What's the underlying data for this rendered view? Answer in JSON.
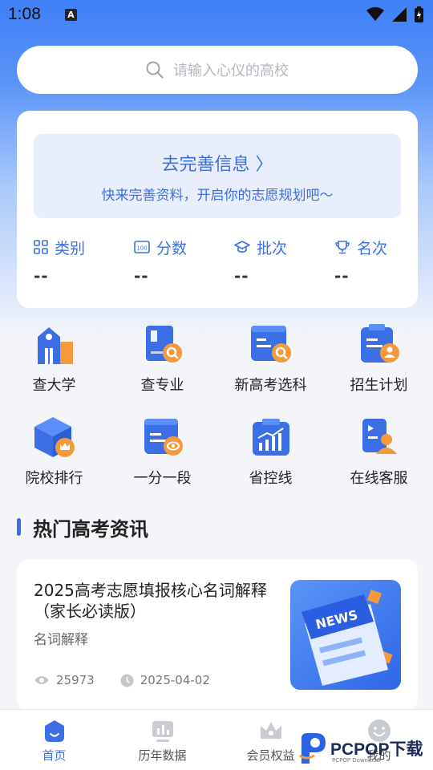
{
  "status": {
    "time": "1:08",
    "notif_badge": "A"
  },
  "search": {
    "placeholder": "请输入心仪的高校"
  },
  "profile": {
    "title": "去完善信息 〉",
    "subtitle": "快来完善资料，开启你的志愿规划吧～",
    "stats": [
      {
        "label": "类别",
        "value": "--",
        "icon": "grid-icon"
      },
      {
        "label": "分数",
        "value": "--",
        "icon": "score-icon"
      },
      {
        "label": "批次",
        "value": "--",
        "icon": "graduation-cap-icon"
      },
      {
        "label": "名次",
        "value": "--",
        "icon": "trophy-icon"
      }
    ]
  },
  "features": [
    {
      "label": "查大学",
      "icon": "university-icon"
    },
    {
      "label": "查专业",
      "icon": "major-search-icon"
    },
    {
      "label": "新高考选科",
      "icon": "subject-select-icon"
    },
    {
      "label": "招生计划",
      "icon": "enrollment-plan-icon"
    },
    {
      "label": "院校排行",
      "icon": "ranking-icon"
    },
    {
      "label": "一分一段",
      "icon": "score-segment-icon"
    },
    {
      "label": "省控线",
      "icon": "control-line-icon"
    },
    {
      "label": "在线客服",
      "icon": "customer-service-icon"
    }
  ],
  "section": {
    "title": "热门高考资讯"
  },
  "news": {
    "title": "2025高考志愿填报核心名词解释（家长必读版）",
    "tag": "名词解释",
    "views": "25973",
    "date": "2025-04-02",
    "image_text": "NEWS"
  },
  "tabs": [
    {
      "label": "首页",
      "icon": "home-icon",
      "active": true
    },
    {
      "label": "历年数据",
      "icon": "data-icon",
      "active": false
    },
    {
      "label": "会员权益",
      "icon": "crown-icon",
      "active": false
    },
    {
      "label": "我的",
      "icon": "profile-icon",
      "active": false
    }
  ],
  "watermark": {
    "brand": "PCPOP下载",
    "sub": "PCPOP Download"
  },
  "colors": {
    "accent": "#3c6fe6",
    "orange": "#f59a3c"
  }
}
